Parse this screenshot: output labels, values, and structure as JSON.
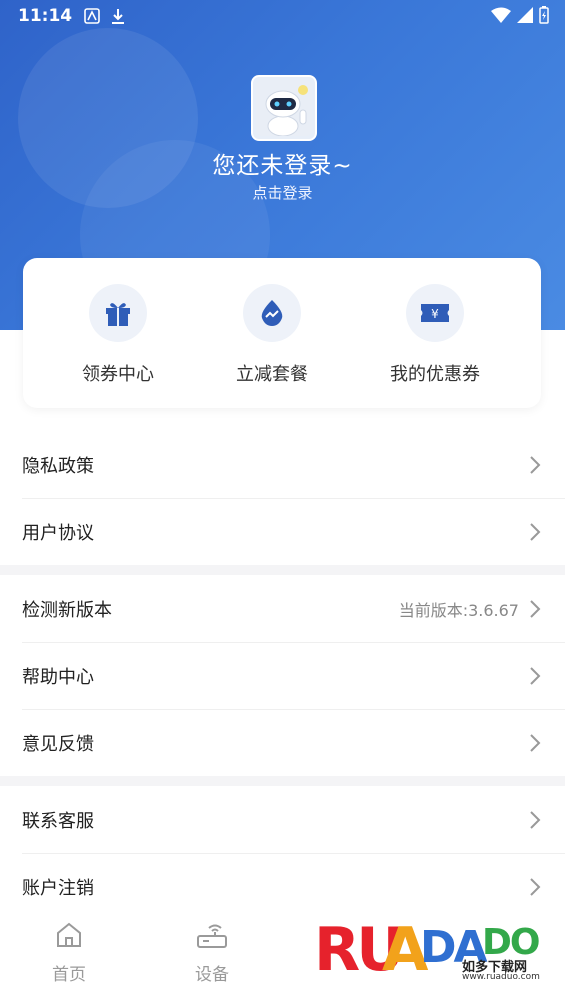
{
  "status": {
    "time": "11:14"
  },
  "profile": {
    "title": "您还未登录~",
    "subtitle": "点击登录"
  },
  "quick_actions": [
    {
      "label": "领券中心",
      "icon": "gift-icon"
    },
    {
      "label": "立减套餐",
      "icon": "drop-trend-icon"
    },
    {
      "label": "我的优惠券",
      "icon": "coupon-yen-icon"
    }
  ],
  "menu": [
    {
      "label": "隐私政策"
    },
    {
      "label": "用户协议"
    },
    {
      "label": "检测新版本",
      "value": "当前版本:3.6.67"
    },
    {
      "label": "帮助中心"
    },
    {
      "label": "意见反馈"
    },
    {
      "label": "联系客服"
    },
    {
      "label": "账户注销"
    }
  ],
  "tabs": [
    {
      "label": "首页",
      "icon": "home-icon"
    },
    {
      "label": "设备",
      "icon": "router-icon"
    }
  ],
  "watermark": {
    "brand": "RUANDAO",
    "cn": "如多下载网",
    "url": "www.ruaduo.com"
  },
  "colors": {
    "header": "#3a77d8",
    "icon_blue": "#2f5db8",
    "icon_bg": "#eef2f9"
  }
}
